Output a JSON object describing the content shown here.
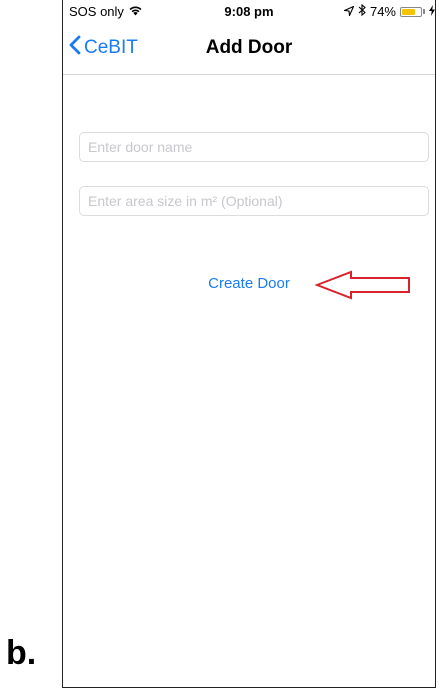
{
  "figure_label": "b.",
  "status_bar": {
    "carrier": "SOS only",
    "wifi_icon": "wifi-icon",
    "time": "9:08 pm",
    "location_icon": "location-arrow-icon",
    "bluetooth_icon": "bluetooth-icon",
    "battery_percent": "74%",
    "battery_level": 0.74,
    "battery_color": "#f5c400",
    "charging_icon": "bolt-icon"
  },
  "nav": {
    "back_label": "CeBIT",
    "back_icon": "chevron-left-icon",
    "title": "Add Door"
  },
  "form": {
    "door_name": {
      "value": "",
      "placeholder": "Enter door name"
    },
    "area_size": {
      "value": "",
      "placeholder": "Enter area size in m² (Optional)"
    },
    "create_label": "Create Door"
  },
  "annotation": {
    "arrow_icon": "red-arrow-icon",
    "color": "#d9232a"
  },
  "colors": {
    "accent": "#1a7cf0",
    "placeholder": "#c7c7cd",
    "border": "#dcdcdc"
  }
}
